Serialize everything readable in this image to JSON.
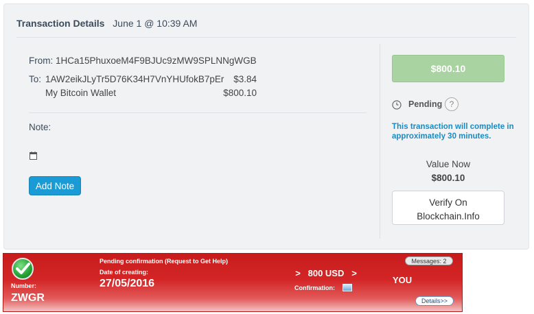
{
  "transaction": {
    "title": "Transaction Details",
    "datetime": "June 1 @ 10:39 AM",
    "from_label": "From:",
    "from_address": "1HCa15PhuxoeM4F9BJUc9zMW9SPLNNgWGB",
    "to_label": "To:",
    "recipients": [
      {
        "name": "1AW2eikJLyTr5D76K34H7VnYHUfokB7pEr",
        "amount": "$3.84"
      },
      {
        "name": "My Bitcoin Wallet",
        "amount": "$800.10"
      }
    ],
    "note_label": "Note:",
    "note_icon": "calendar-icon",
    "add_note_label": "Add Note"
  },
  "sidebar": {
    "amount": "$800.10",
    "status_icon": "clock-icon",
    "status": "Pending",
    "help_symbol": "?",
    "pending_message": "This transaction will complete in approximately 30 minutes.",
    "value_label": "Value Now",
    "value_amount": "$800.10",
    "verify_label_1": "Verify On",
    "verify_label_2": "Blockchain.Info",
    "colors": {
      "amount_button": "#a9d3a0",
      "message": "#1a8ac2",
      "add_note": "#1a9bd6"
    }
  },
  "banner": {
    "badge_icon": "checkmark-icon",
    "number_label": "Number:",
    "number": "ZWGR",
    "pending_text": "Pending confirmation (Request to Get Help)",
    "date_label": "Date of creating:",
    "date": "27/05/2016",
    "amount": ">   800 USD   >",
    "confirmation_label": "Confirmation:",
    "messages": "Messages: 2",
    "recipient": "YOU",
    "details": "Details>>",
    "colors": {
      "background": "#c81c1c",
      "text": "#ffffff"
    }
  }
}
